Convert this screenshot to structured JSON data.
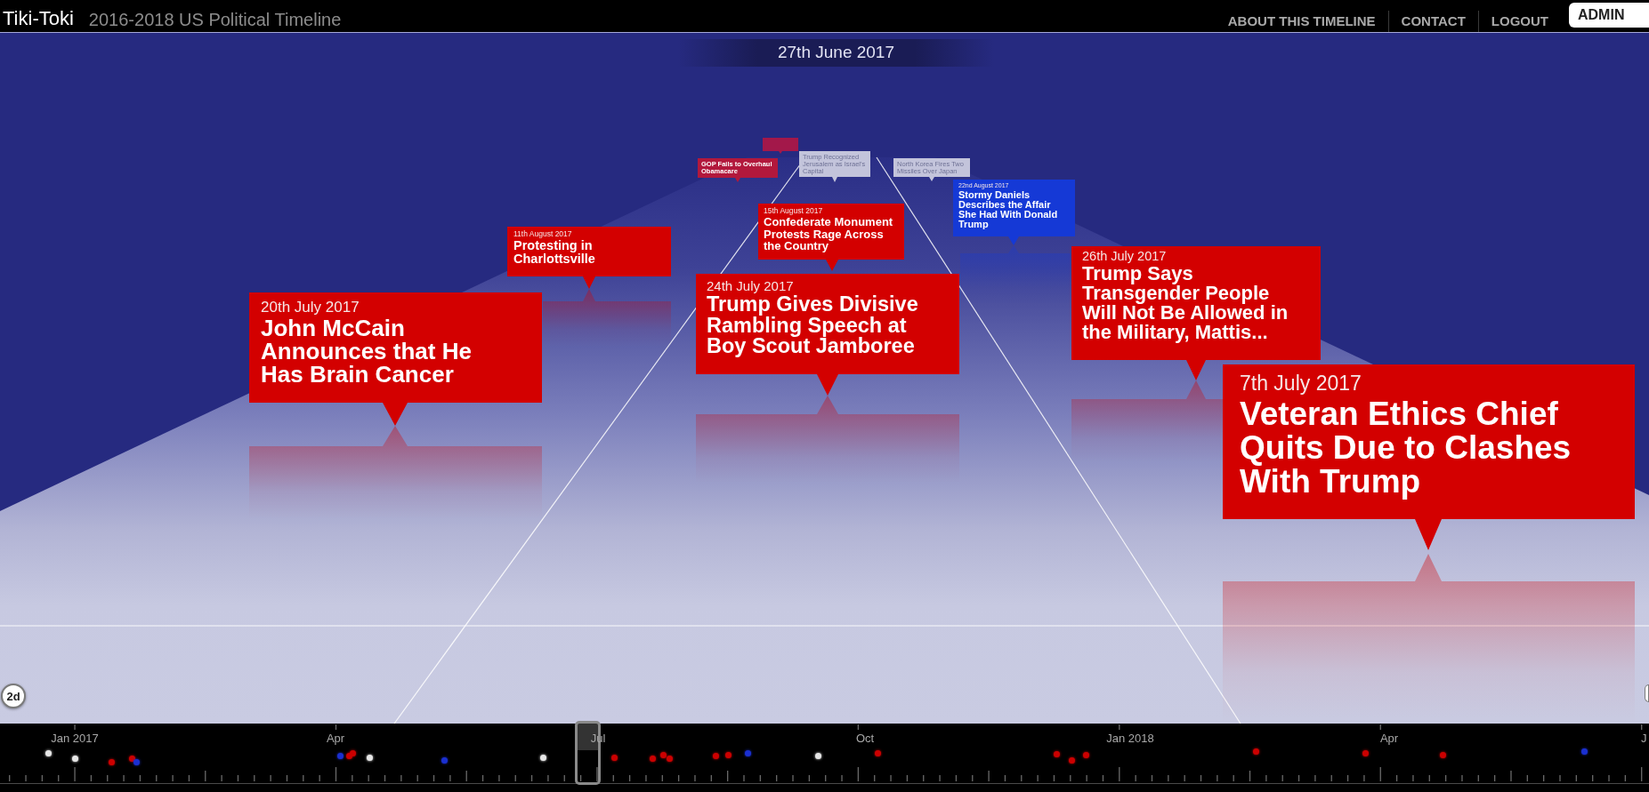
{
  "header": {
    "brand": "Tiki-Toki",
    "title": "2016-2018 US Political Timeline",
    "nav": [
      "ABOUT THIS TIMELINE",
      "CONTACT",
      "LOGOUT"
    ],
    "account": "ADMIN"
  },
  "current_date": "27th June 2017",
  "events": [
    {
      "date": "7th July 2017",
      "title": "Veteran Ethics Chief Quits Due to Clashes With Trump",
      "color": "#d30000"
    },
    {
      "date": "20th July 2017",
      "title": "John McCain Announces that He Has Brain Cancer",
      "color": "#d30000"
    },
    {
      "date": "24th July 2017",
      "title": "Trump Gives Divisive Rambling Speech at Boy Scout Jamboree",
      "color": "#d30000"
    },
    {
      "date": "26th July 2017",
      "title": "Trump Says Transgender People Will Not Be Allowed in the Military, Mattis...",
      "color": "#d30000"
    },
    {
      "date": "11th August 2017",
      "title": "Protesting in Charlottsville",
      "color": "#d30000"
    },
    {
      "date": "15th August 2017",
      "title": "Confederate Monument Protests Rage Across the Country",
      "color": "#d30000"
    },
    {
      "date": "22nd August 2017",
      "title": "Stormy Daniels Describes the Affair She Had With Donald Trump",
      "color": "#1539d6"
    },
    {
      "title": "GOP Fails to Overhaul Obamacare",
      "color": "#b2183c"
    },
    {
      "title": "Trump Recognized Jerusalem as Israel's Capital",
      "color": "#c3c4db"
    },
    {
      "title": "North Korea Fires Two Missiles Over Japan",
      "color": "#c3c4db"
    },
    {
      "color": "#a3184a"
    }
  ],
  "view_toggle": "2d",
  "timeline": {
    "labels": [
      "Jan 2017",
      "Apr",
      "Jul",
      "Oct",
      "Jan 2018",
      "Apr",
      "J"
    ],
    "markers": [
      {
        "color": "#e6e6e6"
      },
      {
        "color": "#e6e6e6"
      },
      {
        "color": "#cc0000"
      },
      {
        "color": "#cc0000"
      },
      {
        "color": "#1a2fd0"
      },
      {
        "color": "#1a2fd0"
      },
      {
        "color": "#cc0000"
      },
      {
        "color": "#cc0000"
      },
      {
        "color": "#e6e6e6"
      },
      {
        "color": "#1a2fd0"
      },
      {
        "color": "#e6e6e6"
      },
      {
        "color": "#cc0000"
      },
      {
        "color": "#cc0000"
      },
      {
        "color": "#cc0000"
      },
      {
        "color": "#cc0000"
      },
      {
        "color": "#cc0000"
      },
      {
        "color": "#cc0000"
      },
      {
        "color": "#1a2fd0"
      },
      {
        "color": "#e6e6e6"
      },
      {
        "color": "#cc0000"
      },
      {
        "color": "#cc0000"
      },
      {
        "color": "#cc0000"
      },
      {
        "color": "#cc0000"
      },
      {
        "color": "#cc0000"
      },
      {
        "color": "#cc0000"
      },
      {
        "color": "#cc0000"
      },
      {
        "color": "#1a2fd0"
      }
    ]
  }
}
